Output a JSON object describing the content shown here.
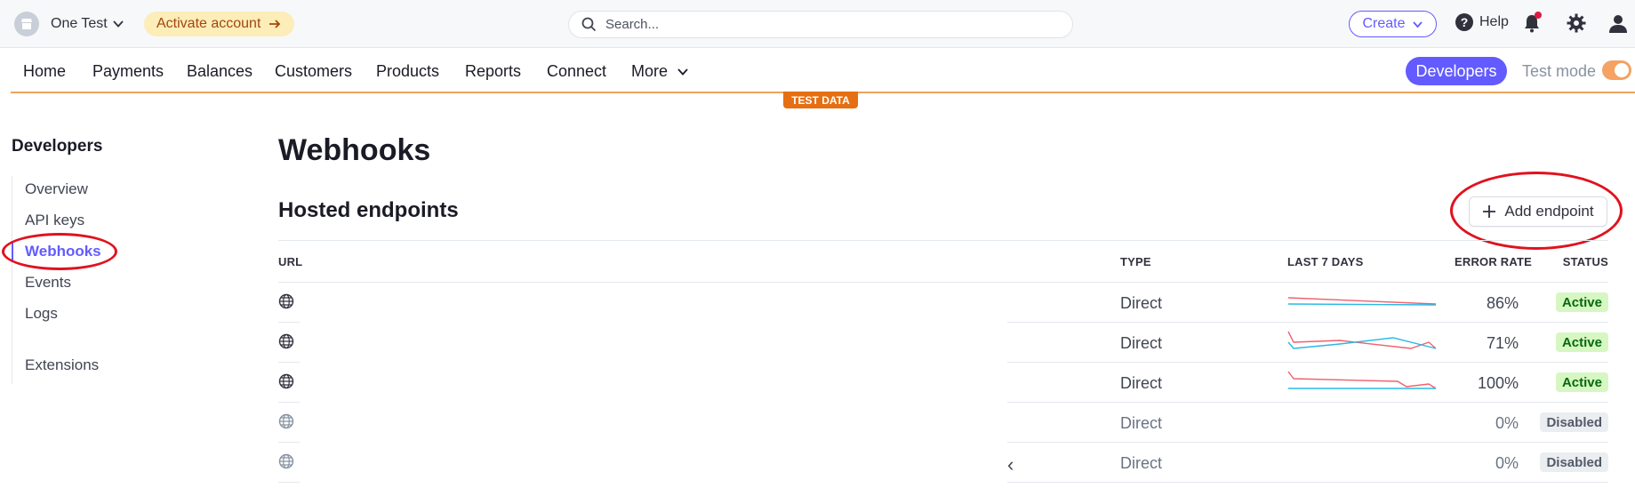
{
  "topbar": {
    "account_name": "One Test",
    "activate_label": "Activate account",
    "search_placeholder": "Search...",
    "create_label": "Create",
    "help_label": "Help"
  },
  "nav": {
    "items": [
      "Home",
      "Payments",
      "Balances",
      "Customers",
      "Products",
      "Reports",
      "Connect",
      "More"
    ],
    "developers_label": "Developers",
    "test_mode_label": "Test mode",
    "test_data_badge": "TEST DATA"
  },
  "sidebar": {
    "title": "Developers",
    "items": [
      "Overview",
      "API keys",
      "Webhooks",
      "Events",
      "Logs",
      "Extensions"
    ],
    "active": "Webhooks"
  },
  "main": {
    "title": "Webhooks",
    "section_title": "Hosted endpoints",
    "add_endpoint_label": "Add endpoint",
    "columns": [
      "URL",
      "TYPE",
      "LAST 7 DAYS",
      "ERROR RATE",
      "STATUS"
    ],
    "rows": [
      {
        "type": "Direct",
        "error_rate": "86%",
        "status": "Active",
        "state": "active"
      },
      {
        "type": "Direct",
        "error_rate": "71%",
        "status": "Active",
        "state": "active"
      },
      {
        "type": "Direct",
        "error_rate": "100%",
        "status": "Active",
        "state": "active"
      },
      {
        "type": "Direct",
        "error_rate": "0%",
        "status": "Disabled",
        "state": "disabled"
      },
      {
        "type": "Direct",
        "error_rate": "0%",
        "status": "Disabled",
        "state": "disabled"
      }
    ],
    "pager_prev": "‹"
  },
  "colors": {
    "accent": "#635bff",
    "test_orange": "#e56f12",
    "spark_error": "#f0616d",
    "spark_success": "#28b8e6",
    "annotation_red": "#e0121f"
  },
  "icons": {
    "account": "storefront-icon",
    "search": "search-icon",
    "help": "help-circle-icon",
    "notifications": "bell-icon",
    "settings": "gear-icon",
    "profile": "user-icon",
    "url_row": "globe-icon"
  }
}
